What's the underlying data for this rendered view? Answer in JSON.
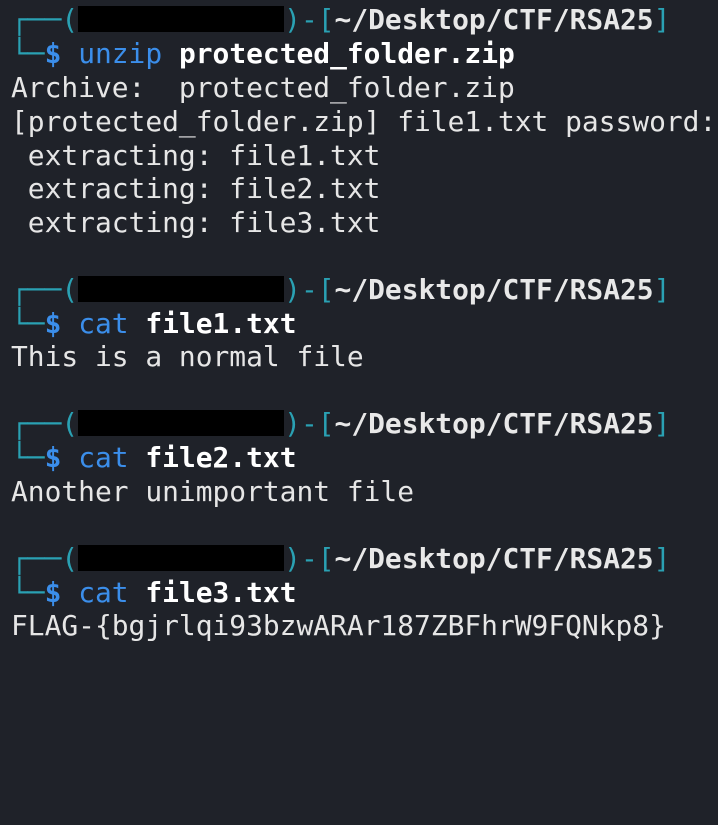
{
  "terminal": {
    "prompt_path": "~/Desktop/CTF/RSA25",
    "blocks": [
      {
        "command": "unzip",
        "argument": "protected_folder.zip",
        "output": [
          "Archive:  protected_folder.zip",
          "[protected_folder.zip] file1.txt password:",
          " extracting: file1.txt",
          " extracting: file2.txt",
          " extracting: file3.txt"
        ]
      },
      {
        "command": "cat",
        "argument": "file1.txt",
        "output": [
          "This is a normal file"
        ]
      },
      {
        "command": "cat",
        "argument": "file2.txt",
        "output": [
          "Another unimportant file"
        ]
      },
      {
        "command": "cat",
        "argument": "file3.txt",
        "output": [
          "FLAG-{bgjrlqi93bzwARAr187ZBFhrW9FQNkp8}"
        ]
      }
    ]
  }
}
